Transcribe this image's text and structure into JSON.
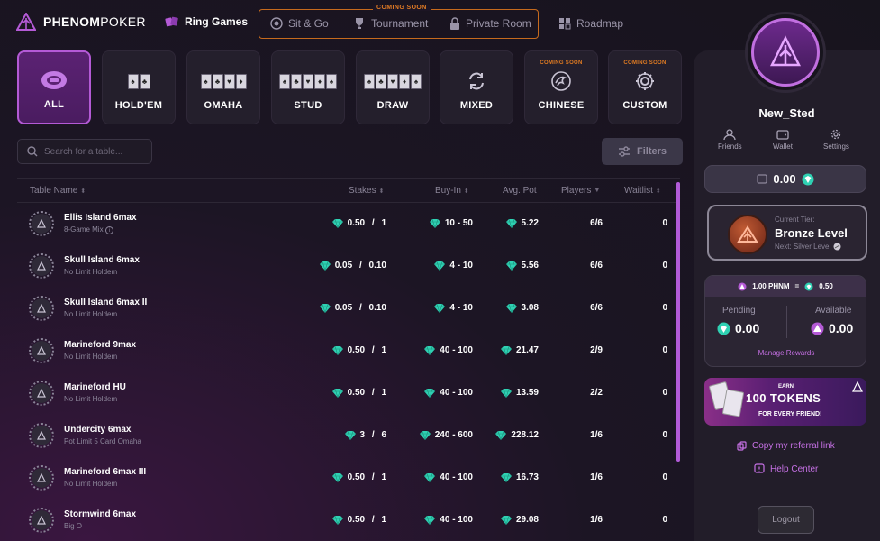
{
  "header": {
    "logo_bold": "PHENOM",
    "logo_light": "POKER",
    "ring_games": "Ring Games",
    "coming_soon": "COMING SOON",
    "sit_go": "Sit & Go",
    "tournament": "Tournament",
    "private_room": "Private Room",
    "roadmap": "Roadmap"
  },
  "categories": [
    {
      "label": "ALL",
      "icon": "chip-icon",
      "active": true
    },
    {
      "label": "HOLD'EM",
      "icon": "two-cards-icon"
    },
    {
      "label": "OMAHA",
      "icon": "four-cards-icon"
    },
    {
      "label": "STUD",
      "icon": "stud-cards-icon"
    },
    {
      "label": "DRAW",
      "icon": "five-cards-icon"
    },
    {
      "label": "MIXED",
      "icon": "refresh-icon"
    },
    {
      "label": "CHINESE",
      "icon": "dragon-icon",
      "soon": "COMING SOON"
    },
    {
      "label": "CUSTOM",
      "icon": "gear-icon",
      "soon": "COMING SOON"
    }
  ],
  "search": {
    "placeholder": "Search for a table..."
  },
  "filters_label": "Filters",
  "table": {
    "headers": [
      "Table Name",
      "Stakes",
      "Buy-In",
      "Avg. Pot",
      "Players",
      "Waitlist"
    ],
    "rows": [
      {
        "name": "Ellis Island 6max",
        "game": "8-Game Mix",
        "stakes_sb": "0.50",
        "stakes_bb": "1",
        "buyin": "10 - 50",
        "avgpot": "5.22",
        "players": "6/6",
        "waitlist": "0",
        "info": true
      },
      {
        "name": "Skull Island 6max",
        "game": "No Limit Holdem",
        "stakes_sb": "0.05",
        "stakes_bb": "0.10",
        "buyin": "4 - 10",
        "avgpot": "5.56",
        "players": "6/6",
        "waitlist": "0"
      },
      {
        "name": "Skull Island 6max II",
        "game": "No Limit Holdem",
        "stakes_sb": "0.05",
        "stakes_bb": "0.10",
        "buyin": "4 - 10",
        "avgpot": "3.08",
        "players": "6/6",
        "waitlist": "0"
      },
      {
        "name": "Marineford 9max",
        "game": "No Limit Holdem",
        "stakes_sb": "0.50",
        "stakes_bb": "1",
        "buyin": "40 - 100",
        "avgpot": "21.47",
        "players": "2/9",
        "waitlist": "0"
      },
      {
        "name": "Marineford HU",
        "game": "No Limit Holdem",
        "stakes_sb": "0.50",
        "stakes_bb": "1",
        "buyin": "40 - 100",
        "avgpot": "13.59",
        "players": "2/2",
        "waitlist": "0"
      },
      {
        "name": "Undercity 6max",
        "game": "Pot Limit 5 Card Omaha",
        "stakes_sb": "3",
        "stakes_bb": "6",
        "buyin": "240 - 600",
        "avgpot": "228.12",
        "players": "1/6",
        "waitlist": "0"
      },
      {
        "name": "Marineford 6max III",
        "game": "No Limit Holdem",
        "stakes_sb": "0.50",
        "stakes_bb": "1",
        "buyin": "40 - 100",
        "avgpot": "16.73",
        "players": "1/6",
        "waitlist": "0"
      },
      {
        "name": "Stormwind 6max",
        "game": "Big O",
        "stakes_sb": "0.50",
        "stakes_bb": "1",
        "buyin": "40 - 100",
        "avgpot": "29.08",
        "players": "1/6",
        "waitlist": "0"
      }
    ]
  },
  "profile": {
    "username": "New_Sted",
    "friends": "Friends",
    "wallet": "Wallet",
    "settings": "Settings",
    "balance": "0.00",
    "tier_label": "Current Tier:",
    "tier_name": "Bronze Level",
    "tier_next": "Next: Silver Level",
    "rate_left": "1.00 PHNM",
    "rate_eq": "=",
    "rate_right": "0.50",
    "pending_label": "Pending",
    "pending_value": "0.00",
    "available_label": "Available",
    "available_value": "0.00",
    "manage_rewards": "Manage Rewards",
    "promo_earn": "EARN",
    "promo_tokens": "100 TOKENS",
    "promo_sub": "FOR EVERY FRIEND!",
    "referral": "Copy my referral link",
    "help": "Help Center",
    "logout": "Logout"
  },
  "colors": {
    "accent": "#b45ad6",
    "coming_soon": "#e07b22",
    "gem": "#2fd1b3"
  }
}
